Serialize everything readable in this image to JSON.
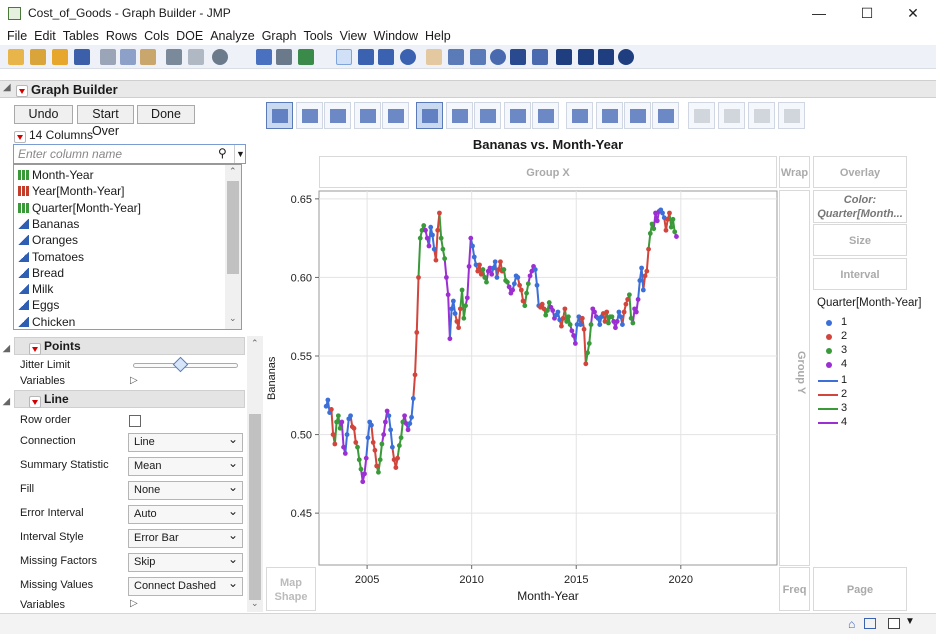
{
  "window": {
    "title": "Cost_of_Goods - Graph Builder - JMP",
    "min": "—",
    "max": "☐",
    "close": "✕"
  },
  "menu": [
    "File",
    "Edit",
    "Tables",
    "Rows",
    "Cols",
    "DOE",
    "Analyze",
    "Graph",
    "Tools",
    "View",
    "Window",
    "Help"
  ],
  "panel": {
    "title": "Graph Builder",
    "undo": "Undo",
    "start_over": "Start Over",
    "done": "Done",
    "columns_count": "14 Columns",
    "search_placeholder": "Enter column name"
  },
  "columns": [
    {
      "name": "Month-Year",
      "type": "cont-green"
    },
    {
      "name": "Year[Month-Year]",
      "type": "nom-red"
    },
    {
      "name": "Quarter[Month-Year]",
      "type": "cont-green"
    },
    {
      "name": "Bananas",
      "type": "cont-blue"
    },
    {
      "name": "Oranges",
      "type": "cont-blue"
    },
    {
      "name": "Tomatoes",
      "type": "cont-blue"
    },
    {
      "name": "Bread",
      "type": "cont-blue"
    },
    {
      "name": "Milk",
      "type": "cont-blue"
    },
    {
      "name": "Eggs",
      "type": "cont-blue"
    },
    {
      "name": "Chicken",
      "type": "cont-blue"
    }
  ],
  "points_section": {
    "title": "Points",
    "jitter_label": "Jitter Limit",
    "jitter_value": 0.45,
    "variables_label": "Variables"
  },
  "line_section": {
    "title": "Line",
    "row_order_label": "Row order",
    "props": [
      {
        "label": "Connection",
        "value": "Line"
      },
      {
        "label": "Summary Statistic",
        "value": "Mean"
      },
      {
        "label": "Fill",
        "value": "None"
      },
      {
        "label": "Error Interval",
        "value": "Auto"
      },
      {
        "label": "Interval Style",
        "value": "Error Bar"
      },
      {
        "label": "Missing Factors",
        "value": "Skip"
      },
      {
        "label": "Missing Values",
        "value": "Connect Dashed"
      }
    ],
    "variables_label": "Variables"
  },
  "zones": {
    "group_x": "Group X",
    "group_y": "Group Y",
    "wrap": "Wrap",
    "overlay": "Overlay",
    "color": "Color:\nQuarter[Month...",
    "size": "Size",
    "interval": "Interval",
    "freq": "Freq",
    "page": "Page",
    "map_shape": "Map\nShape"
  },
  "legend": {
    "title": "Quarter[Month-Year]",
    "items": [
      "1",
      "2",
      "3",
      "4"
    ]
  },
  "colors": {
    "q1": "#3c6fd8",
    "q2": "#d1453c",
    "q3": "#3a9a3a",
    "q4": "#9b2fd1"
  },
  "chart_data": {
    "type": "line",
    "title": "Bananas vs. Month-Year",
    "xlabel": "Month-Year",
    "ylabel": "Bananas",
    "xlim": [
      2002.7,
      2024.6
    ],
    "ylim": [
      0.417,
      0.655
    ],
    "xticks": [
      2005,
      2010,
      2015,
      2020
    ],
    "yticks": [
      0.45,
      0.5,
      0.55,
      0.6,
      0.65
    ],
    "y_tick_labels": [
      "0.45",
      "0.50",
      "0.55",
      "0.60",
      "0.65"
    ],
    "grid": true,
    "legend_position": "right",
    "start_year": 2003,
    "color_by": "quarter",
    "series_monthly": [
      0.518,
      0.522,
      0.514,
      0.516,
      0.5,
      0.494,
      0.508,
      0.512,
      0.504,
      0.508,
      0.492,
      0.488,
      0.5,
      0.51,
      0.512,
      0.505,
      0.504,
      0.495,
      0.492,
      0.484,
      0.478,
      0.47,
      0.475,
      0.485,
      0.498,
      0.508,
      0.506,
      0.495,
      0.49,
      0.48,
      0.476,
      0.484,
      0.494,
      0.5,
      0.508,
      0.515,
      0.512,
      0.503,
      0.492,
      0.484,
      0.479,
      0.485,
      0.493,
      0.498,
      0.508,
      0.512,
      0.507,
      0.503,
      0.507,
      0.511,
      0.523,
      0.538,
      0.565,
      0.6,
      0.625,
      0.63,
      0.633,
      0.63,
      0.625,
      0.62,
      0.632,
      0.627,
      0.618,
      0.611,
      0.63,
      0.641,
      0.625,
      0.618,
      0.612,
      0.6,
      0.589,
      0.561,
      0.58,
      0.585,
      0.577,
      0.572,
      0.568,
      0.58,
      0.592,
      0.574,
      0.582,
      0.587,
      0.607,
      0.625,
      0.62,
      0.613,
      0.608,
      0.604,
      0.608,
      0.602,
      0.605,
      0.6,
      0.597,
      0.604,
      0.606,
      0.602,
      0.606,
      0.61,
      0.6,
      0.605,
      0.61,
      0.604,
      0.605,
      0.598,
      0.597,
      0.594,
      0.59,
      0.592,
      0.596,
      0.601,
      0.6,
      0.595,
      0.592,
      0.585,
      0.582,
      0.59,
      0.596,
      0.601,
      0.604,
      0.607,
      0.605,
      0.595,
      0.582,
      0.581,
      0.583,
      0.58,
      0.576,
      0.579,
      0.584,
      0.581,
      0.579,
      0.574,
      0.576,
      0.578,
      0.573,
      0.569,
      0.574,
      0.58,
      0.572,
      0.575,
      0.57,
      0.566,
      0.563,
      0.558,
      0.57,
      0.575,
      0.57,
      0.574,
      0.567,
      0.545,
      0.552,
      0.558,
      0.57,
      0.58,
      0.578,
      0.575,
      0.574,
      0.57,
      0.575,
      0.577,
      0.572,
      0.578,
      0.571,
      0.575,
      0.575,
      0.572,
      0.568,
      0.572,
      0.578,
      0.575,
      0.57,
      0.578,
      0.583,
      0.586,
      0.589,
      0.574,
      0.571,
      0.58,
      0.578,
      0.586,
      0.598,
      0.606,
      0.592,
      0.601,
      0.604,
      0.618,
      0.628,
      0.634,
      0.631,
      0.641,
      0.636,
      0.642,
      0.643,
      0.641,
      0.638,
      0.63,
      0.637,
      0.641,
      0.632,
      0.637,
      0.629,
      0.626
    ]
  }
}
